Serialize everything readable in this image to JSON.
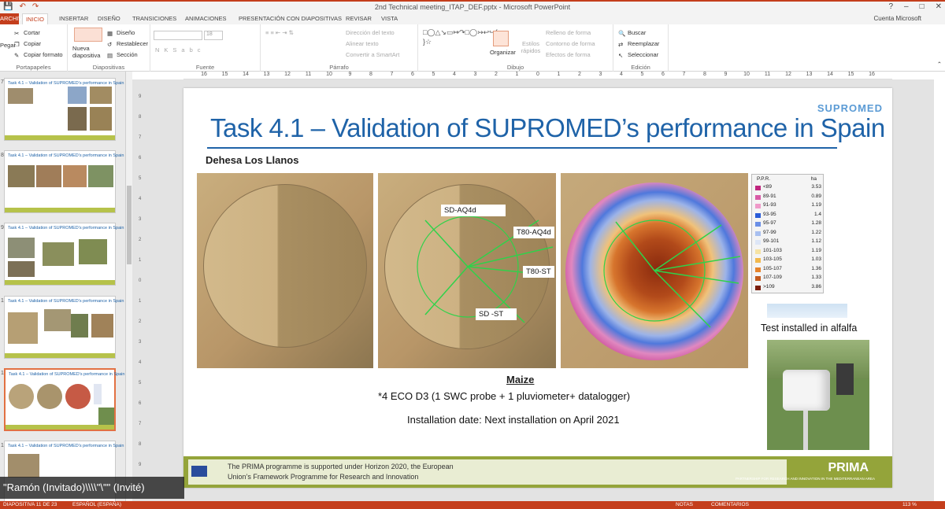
{
  "window": {
    "title": "2nd Technical meeting_ITAP_DEF.pptx - Microsoft PowerPoint",
    "account": "Cuenta Microsoft"
  },
  "tabs": [
    "ARCHIVO",
    "INICIO",
    "INSERTAR",
    "DISEÑO",
    "TRANSICIONES",
    "ANIMACIONES",
    "PRESENTACIÓN CON DIAPOSITIVAS",
    "REVISAR",
    "VISTA"
  ],
  "ribbon": {
    "portapapeles": {
      "label": "Portapapeles",
      "pegar": "Pegar",
      "cortar": "Cortar",
      "copiar": "Copiar",
      "formato": "Copiar formato"
    },
    "diapositivas": {
      "label": "Diapositivas",
      "nueva": "Nueva diapositiva",
      "diseno": "Diseño",
      "restablecer": "Restablecer",
      "seccion": "Sección"
    },
    "fuente": {
      "label": "Fuente",
      "size": "18"
    },
    "parrafo": {
      "label": "Párrafo",
      "direccion": "Dirección del texto",
      "alinear": "Alinear texto",
      "smartart": "Convertir a SmartArt"
    },
    "dibujo": {
      "label": "Dibujo",
      "organizar": "Organizar",
      "estilos": "Estilos rápidos",
      "relleno": "Relleno de forma",
      "contorno": "Contorno de forma",
      "efectos": "Efectos de forma"
    },
    "edicion": {
      "label": "Edición",
      "buscar": "Buscar",
      "reemplazar": "Reemplazar",
      "seleccionar": "Seleccionar"
    }
  },
  "ruler_ticks": [
    "16",
    "15",
    "14",
    "13",
    "12",
    "11",
    "10",
    "9",
    "8",
    "7",
    "6",
    "5",
    "4",
    "3",
    "2",
    "1",
    "0",
    "1",
    "2",
    "3",
    "4",
    "5",
    "6",
    "7",
    "8",
    "9",
    "10",
    "11",
    "12",
    "13",
    "14",
    "15",
    "16"
  ],
  "thumbnails": [
    {
      "title": "Task 4.1 – Validation of SUPROMED’s performance in Spain"
    },
    {
      "title": "Task 4.1 – Validation of SUPROMED’s performance in Spain"
    },
    {
      "title": "Task 4.1 – Validation of SUPROMED’s performance in Spain"
    },
    {
      "title": "Task 4.1 – Validation of SUPROMED’s performance in Spain"
    },
    {
      "title": "Task 4.1 – Validation of SUPROMED’s performance in Spain"
    },
    {
      "title": "Task 4.1 – Validation of SUPROMED’s performance in Spain"
    }
  ],
  "slide": {
    "title": "Task 4.1 – Validation of SUPROMED’s performance in Spain",
    "logo": "SUPROMED",
    "subheading": "Dehesa Los Llanos",
    "callouts": [
      "SD-AQ4d",
      "T80-AQ4d",
      "T80-ST",
      "SD -ST"
    ],
    "legend": {
      "header_left": "P.P.R.",
      "header_right": "ha",
      "rows": [
        {
          "label": "<89",
          "value": "3.53",
          "color": "#c0267e"
        },
        {
          "label": "89-91",
          "value": "0.89",
          "color": "#d85aa6"
        },
        {
          "label": "91-93",
          "value": "1.19",
          "color": "#ef9ac9"
        },
        {
          "label": "93-95",
          "value": "1.4",
          "color": "#2a5cd8"
        },
        {
          "label": "95-97",
          "value": "1.28",
          "color": "#6b8fe6"
        },
        {
          "label": "97-99",
          "value": "1.22",
          "color": "#a9c0f0"
        },
        {
          "label": "99-101",
          "value": "1.12",
          "color": "#dde6f7"
        },
        {
          "label": "101-103",
          "value": "1.19",
          "color": "#f6e3a3"
        },
        {
          "label": "103-105",
          "value": "1.03",
          "color": "#f2b94d"
        },
        {
          "label": "105-107",
          "value": "1.36",
          "color": "#e6832b"
        },
        {
          "label": "107-109",
          "value": "1.33",
          "color": "#c45a1e"
        },
        {
          "label": ">109",
          "value": "3.86",
          "color": "#7a1d0c"
        }
      ]
    },
    "test_label": "Test installed in alfalfa",
    "crop": "Maize",
    "equipment": "*4 ECO D3 (1 SWC probe + 1 pluviometer+ datalogger)",
    "installation": "Installation date: Next installation on April 2021",
    "footer_line1": "The PRIMA programme is supported under Horizon 2020, the European",
    "footer_line2": "Union’s Framework Programme for Research and Innovation",
    "footer_logo": "PRIMA",
    "footer_logo_sub": "PARTNERSHIP FOR RESEARCH AND INNOVATION IN THE MEDITERRANEAN AREA"
  },
  "participant": "\"Ramón (Invitado)\\\\\\\\\"\\\"\" (Invité)",
  "status": {
    "slide": "DIAPOSITIVA 11 DE 23",
    "language": "ESPAÑOL (ESPAÑA)",
    "notes": "NOTAS",
    "comments": "COMENTARIOS",
    "zoom": "113 %"
  }
}
